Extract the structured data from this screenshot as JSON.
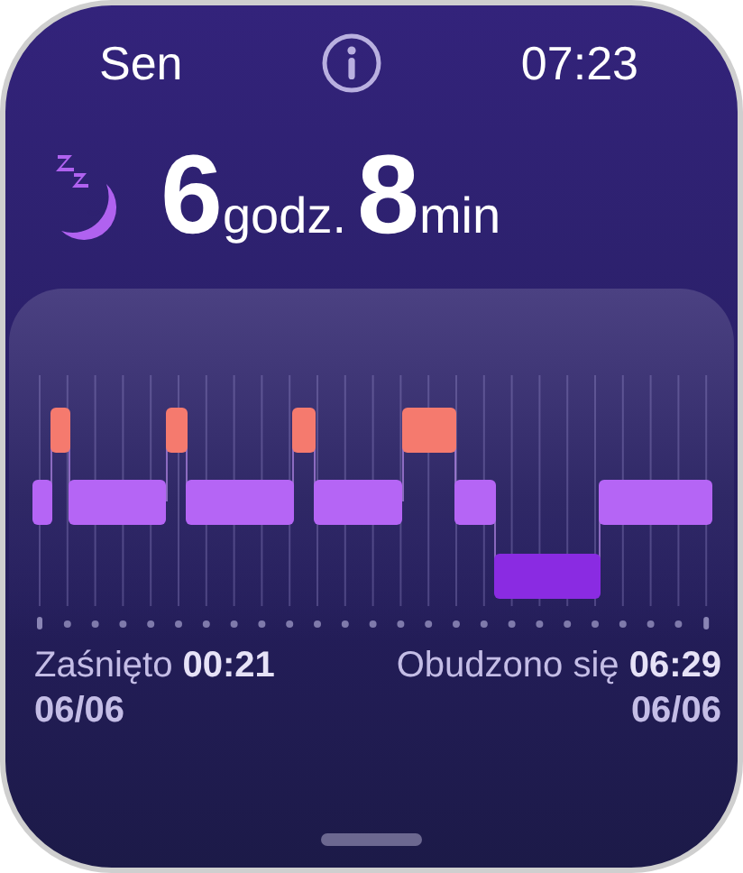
{
  "header": {
    "title": "Sen",
    "time": "07:23"
  },
  "duration": {
    "hours": "6",
    "hours_unit": "godz.",
    "minutes": "8",
    "minutes_unit": "min"
  },
  "fell_asleep": {
    "text": "Zaśnięto **00:21**",
    "date": "06/06"
  },
  "woke_up": {
    "text": "Obudzono się **06:29**",
    "date": "06/06"
  }
}
